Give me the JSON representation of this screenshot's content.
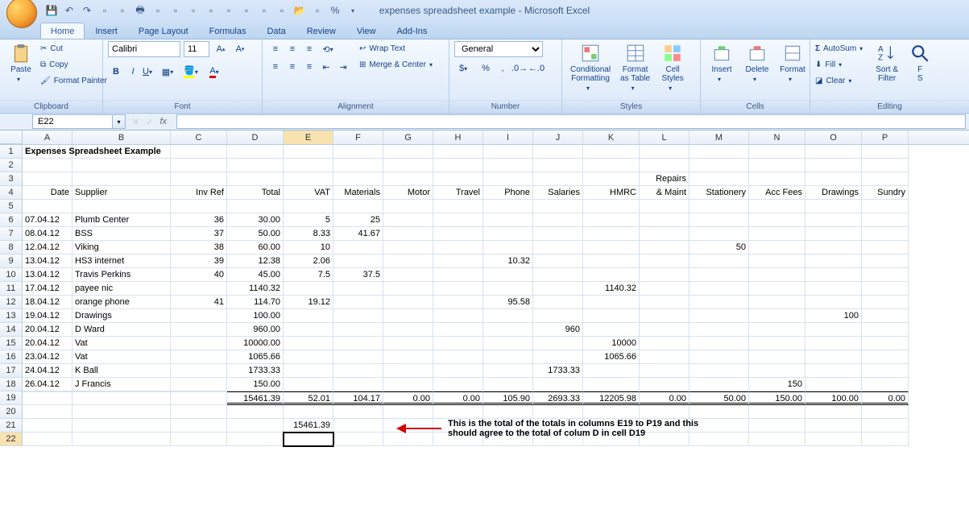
{
  "title": "expenses spreadsheet example - Microsoft Excel",
  "tabs": [
    "Home",
    "Insert",
    "Page Layout",
    "Formulas",
    "Data",
    "Review",
    "View",
    "Add-Ins"
  ],
  "active_tab": 0,
  "clipboard": {
    "paste": "Paste",
    "cut": "Cut",
    "copy": "Copy",
    "fpaint": "Format Painter",
    "label": "Clipboard"
  },
  "font": {
    "name": "Calibri",
    "size": "11",
    "label": "Font"
  },
  "alignment": {
    "wrap": "Wrap Text",
    "merge": "Merge & Center",
    "label": "Alignment"
  },
  "number": {
    "format": "General",
    "label": "Number"
  },
  "styles": {
    "cf": "Conditional\nFormatting",
    "fat": "Format\nas Table",
    "cs": "Cell\nStyles",
    "label": "Styles"
  },
  "cells": {
    "ins": "Insert",
    "del": "Delete",
    "fmt": "Format",
    "label": "Cells"
  },
  "editing": {
    "autosum": "AutoSum",
    "fill": "Fill",
    "clear": "Clear",
    "sort": "Sort &\nFilter",
    "find": "F\nS",
    "label": "Editing"
  },
  "namebox": "E22",
  "formula": "",
  "cols": [
    "A",
    "B",
    "C",
    "D",
    "E",
    "F",
    "G",
    "H",
    "I",
    "J",
    "K",
    "L",
    "M",
    "N",
    "O",
    "P"
  ],
  "row_numbers": [
    "1",
    "2",
    "3",
    "4",
    "5",
    "6",
    "7",
    "8",
    "9",
    "10",
    "11",
    "12",
    "13",
    "14",
    "15",
    "16",
    "17",
    "18",
    "19",
    "20",
    "21",
    "22"
  ],
  "cells_data": {
    "1": {
      "A": "Expenses Spreadsheet Example"
    },
    "3": {
      "L": "Repairs"
    },
    "4": {
      "A": "Date",
      "B": "Supplier",
      "C": "Inv Ref",
      "D": "Total",
      "E": "VAT",
      "F": "Materials",
      "G": "Motor",
      "H": "Travel",
      "I": "Phone",
      "J": "Salaries",
      "K": "HMRC",
      "L": "& Maint",
      "M": "Stationery",
      "N": "Acc Fees",
      "O": "Drawings",
      "P": "Sundry"
    },
    "6": {
      "A": "07.04.12",
      "B": "Plumb Center",
      "C": "36",
      "D": "30.00",
      "E": "5",
      "F": "25"
    },
    "7": {
      "A": "08.04.12",
      "B": "BSS",
      "C": "37",
      "D": "50.00",
      "E": "8.33",
      "F": "41.67"
    },
    "8": {
      "A": "12.04.12",
      "B": "Viking",
      "C": "38",
      "D": "60.00",
      "E": "10",
      "M": "50"
    },
    "9": {
      "A": "13.04.12",
      "B": "HS3 internet",
      "C": "39",
      "D": "12.38",
      "E": "2.06",
      "I": "10.32"
    },
    "10": {
      "A": "13.04.12",
      "B": "Travis Perkins",
      "C": "40",
      "D": "45.00",
      "E": "7.5",
      "F": "37.5"
    },
    "11": {
      "A": "17.04.12",
      "B": "payee nic",
      "D": "1140.32",
      "K": "1140.32"
    },
    "12": {
      "A": "18.04.12",
      "B": "orange phone",
      "C": "41",
      "D": "114.70",
      "E": "19.12",
      "I": "95.58"
    },
    "13": {
      "A": "19.04.12",
      "B": "Drawings",
      "D": "100.00",
      "O": "100"
    },
    "14": {
      "A": "20.04.12",
      "B": "D Ward",
      "D": "960.00",
      "J": "960"
    },
    "15": {
      "A": "20.04.12",
      "B": "Vat",
      "D": "10000.00",
      "K": "10000"
    },
    "16": {
      "A": "23.04.12",
      "B": "Vat",
      "D": "1065.66",
      "K": "1065.66"
    },
    "17": {
      "A": "24.04.12",
      "B": "K Ball",
      "D": "1733.33",
      "J": "1733.33"
    },
    "18": {
      "A": "26.04.12",
      "B": "J Francis",
      "D": "150.00",
      "N": "150"
    },
    "19": {
      "D": "15461.39",
      "E": "52.01",
      "F": "104.17",
      "G": "0.00",
      "H": "0.00",
      "I": "105.90",
      "J": "2693.33",
      "K": "12205.98",
      "L": "0.00",
      "M": "50.00",
      "N": "150.00",
      "O": "100.00",
      "P": "0.00"
    },
    "21": {
      "E": "15461.39"
    }
  },
  "annotation": "This is the total of the totals in columns E19 to P19 and this\nshould agree to the total of colum D in cell D19",
  "selected_cell": "E22",
  "active_col": "E",
  "active_row": "22"
}
